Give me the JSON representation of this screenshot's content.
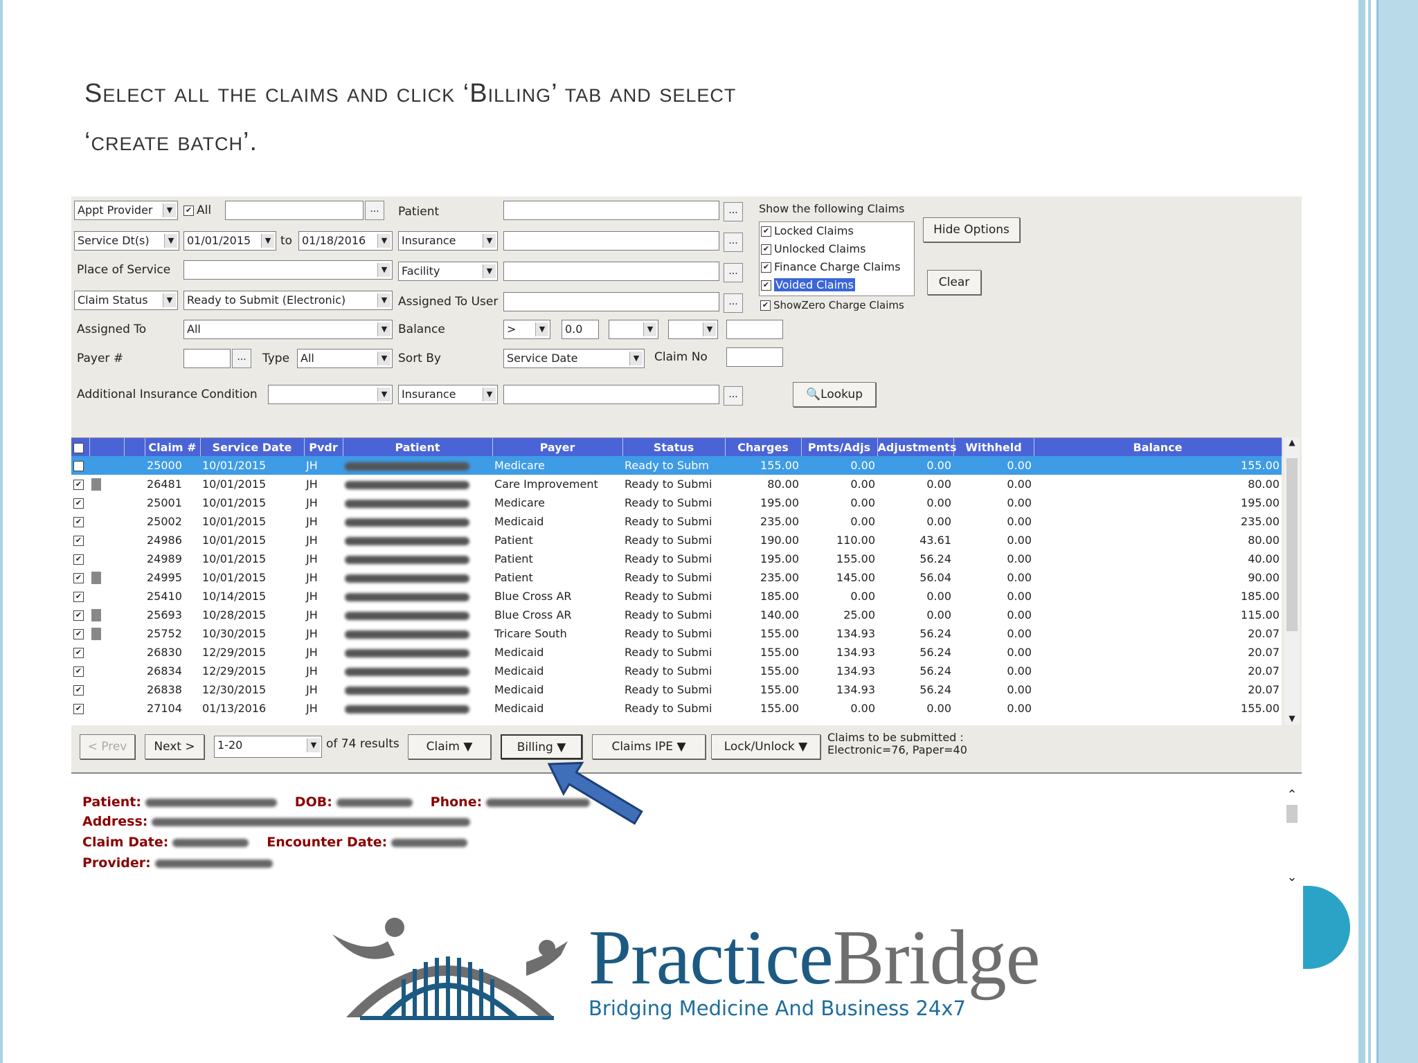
{
  "title_lines": [
    "Select all the claims and click ‘Billing’ tab and select",
    "‘create batch’."
  ],
  "filters": {
    "appt_provider": "Appt Provider",
    "all_label": "All",
    "service_dt": "Service Dt(s)",
    "from_date": "01/01/2015",
    "to_label": "to",
    "to_date": "01/18/2016",
    "place_of_service": "Place of Service",
    "claim_status": "Claim Status",
    "claim_status_value": "Ready to Submit (Electronic)",
    "assigned_to": "Assigned To",
    "assigned_to_value": "All",
    "payer_no": "Payer #",
    "type_label": "Type",
    "type_value": "All",
    "additional_insurance": "Additional Insurance Condition",
    "patient": "Patient",
    "insurance": "Insurance",
    "facility": "Facility",
    "assigned_to_user": "Assigned To User",
    "balance": "Balance",
    "balance_op": ">",
    "balance_value": "0.0",
    "sort_by": "Sort By",
    "sort_by_value": "Service Date",
    "claim_no": "Claim No",
    "insurance2": "Insurance"
  },
  "show_claims": {
    "heading": "Show the following Claims",
    "options": [
      "Locked Claims",
      "Unlocked Claims",
      "Finance Charge Claims",
      "Voided Claims"
    ],
    "show_zero": "ShowZero Charge Claims"
  },
  "buttons": {
    "hide_options": "Hide Options",
    "clear": "Clear",
    "lookup": "Lookup"
  },
  "grid": {
    "columns": [
      "Claim #",
      "Service Date",
      "Pvdr",
      "Patient",
      "Payer",
      "Status",
      "Charges",
      "Pmts/Adjs",
      "Adjustments",
      "Withheld",
      "Balance"
    ],
    "rows": [
      {
        "claim": "25000",
        "date": "10/01/2015",
        "pvdr": "JH",
        "payer": "Medicare",
        "status": "Ready to Subm",
        "charges": "155.00",
        "pmts": "0.00",
        "adj": "0.00",
        "withheld": "0.00",
        "balance": "155.00"
      },
      {
        "claim": "26481",
        "date": "10/01/2015",
        "pvdr": "JH",
        "payer": "Care Improvement",
        "status": "Ready to Submi",
        "charges": "80.00",
        "pmts": "0.00",
        "adj": "0.00",
        "withheld": "0.00",
        "balance": "80.00"
      },
      {
        "claim": "25001",
        "date": "10/01/2015",
        "pvdr": "JH",
        "payer": "Medicare",
        "status": "Ready to Submi",
        "charges": "195.00",
        "pmts": "0.00",
        "adj": "0.00",
        "withheld": "0.00",
        "balance": "195.00"
      },
      {
        "claim": "25002",
        "date": "10/01/2015",
        "pvdr": "JH",
        "payer": "Medicaid",
        "status": "Ready to Submi",
        "charges": "235.00",
        "pmts": "0.00",
        "adj": "0.00",
        "withheld": "0.00",
        "balance": "235.00"
      },
      {
        "claim": "24986",
        "date": "10/01/2015",
        "pvdr": "JH",
        "payer": "Patient",
        "status": "Ready to Submi",
        "charges": "190.00",
        "pmts": "110.00",
        "adj": "43.61",
        "withheld": "0.00",
        "balance": "80.00"
      },
      {
        "claim": "24989",
        "date": "10/01/2015",
        "pvdr": "JH",
        "payer": "Patient",
        "status": "Ready to Submi",
        "charges": "195.00",
        "pmts": "155.00",
        "adj": "56.24",
        "withheld": "0.00",
        "balance": "40.00"
      },
      {
        "claim": "24995",
        "date": "10/01/2015",
        "pvdr": "JH",
        "payer": "Patient",
        "status": "Ready to Submi",
        "charges": "235.00",
        "pmts": "145.00",
        "adj": "56.04",
        "withheld": "0.00",
        "balance": "90.00"
      },
      {
        "claim": "25410",
        "date": "10/14/2015",
        "pvdr": "JH",
        "payer": "Blue Cross AR",
        "status": "Ready to Submi",
        "charges": "185.00",
        "pmts": "0.00",
        "adj": "0.00",
        "withheld": "0.00",
        "balance": "185.00"
      },
      {
        "claim": "25693",
        "date": "10/28/2015",
        "pvdr": "JH",
        "payer": "Blue Cross AR",
        "status": "Ready to Submi",
        "charges": "140.00",
        "pmts": "25.00",
        "adj": "0.00",
        "withheld": "0.00",
        "balance": "115.00"
      },
      {
        "claim": "25752",
        "date": "10/30/2015",
        "pvdr": "JH",
        "payer": "Tricare South",
        "status": "Ready to Submi",
        "charges": "155.00",
        "pmts": "134.93",
        "adj": "56.24",
        "withheld": "0.00",
        "balance": "20.07"
      },
      {
        "claim": "26830",
        "date": "12/29/2015",
        "pvdr": "JH",
        "payer": "Medicaid",
        "status": "Ready to Submi",
        "charges": "155.00",
        "pmts": "134.93",
        "adj": "56.24",
        "withheld": "0.00",
        "balance": "20.07"
      },
      {
        "claim": "26834",
        "date": "12/29/2015",
        "pvdr": "JH",
        "payer": "Medicaid",
        "status": "Ready to Submi",
        "charges": "155.00",
        "pmts": "134.93",
        "adj": "56.24",
        "withheld": "0.00",
        "balance": "20.07"
      },
      {
        "claim": "26838",
        "date": "12/30/2015",
        "pvdr": "JH",
        "payer": "Medicaid",
        "status": "Ready to Submi",
        "charges": "155.00",
        "pmts": "134.93",
        "adj": "56.24",
        "withheld": "0.00",
        "balance": "20.07"
      },
      {
        "claim": "27104",
        "date": "01/13/2016",
        "pvdr": "JH",
        "payer": "Medicaid",
        "status": "Ready to Submi",
        "charges": "155.00",
        "pmts": "0.00",
        "adj": "0.00",
        "withheld": "0.00",
        "balance": "155.00"
      }
    ]
  },
  "pager": {
    "prev": "< Prev",
    "next": "Next >",
    "range": "1-20",
    "results": "of 74 results",
    "claim_menu": "Claim",
    "billing_menu": "Billing",
    "claims_ipe": "Claims IPE",
    "lock_unlock": "Lock/Unlock",
    "submit_line1": "Claims to be submitted :",
    "submit_line2": "Electronic=76, Paper=40"
  },
  "info_panel": {
    "patient": "Patient:",
    "dob": "DOB:",
    "phone": "Phone:",
    "address": "Address:",
    "claim_date": "Claim Date:",
    "encounter_date": "Encounter Date:",
    "provider": "Provider:"
  },
  "logo": {
    "name_part1": "Practice",
    "name_part2": "Bridge",
    "tagline": "Bridging Medicine And Business 24x7"
  },
  "colors": {
    "grid_header": "#4a63d6",
    "selected_row": "#3e9be6",
    "info_label": "#8b0000",
    "accent": "#2ba3c6",
    "arrow": "#3e6fb8"
  }
}
